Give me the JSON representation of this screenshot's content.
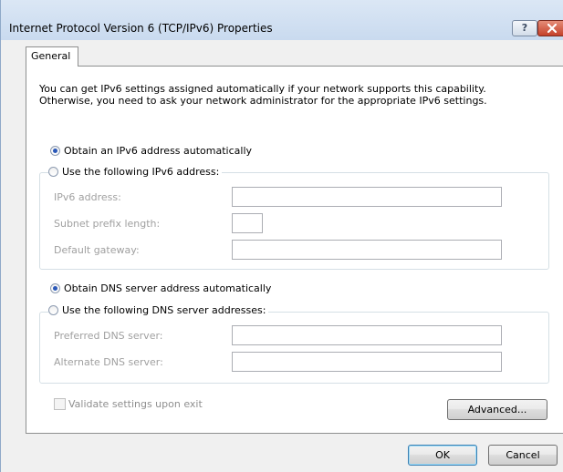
{
  "window": {
    "title": "Internet Protocol Version 6 (TCP/IPv6) Properties",
    "help_label": "?"
  },
  "tabs": [
    {
      "label": "General"
    }
  ],
  "description": {
    "line1": "You can get IPv6 settings assigned automatically if your network supports this capability.",
    "line2": "Otherwise, you need to ask your network administrator for the appropriate IPv6 settings."
  },
  "ip_section": {
    "auto_label": "Obtain an IPv6 address automatically",
    "auto_checked": true,
    "manual_label": "Use the following IPv6 address:",
    "manual_checked": false,
    "fields": {
      "address_label": "IPv6 address:",
      "address_value": "",
      "prefix_label": "Subnet prefix length:",
      "prefix_value": "",
      "gateway_label": "Default gateway:",
      "gateway_value": ""
    }
  },
  "dns_section": {
    "auto_label": "Obtain DNS server address automatically",
    "auto_checked": true,
    "manual_label": "Use the following DNS server addresses:",
    "manual_checked": false,
    "fields": {
      "preferred_label": "Preferred DNS server:",
      "preferred_value": "",
      "alternate_label": "Alternate DNS server:",
      "alternate_value": ""
    }
  },
  "validate": {
    "label": "Validate settings upon exit",
    "checked": false,
    "enabled": false
  },
  "buttons": {
    "advanced": "Advanced...",
    "ok": "OK",
    "cancel": "Cancel"
  },
  "colors": {
    "titlebar": "#c9daef",
    "close_button": "#c5412a",
    "radio_dot": "#2a58b8",
    "disabled_text": "#a0a0a0",
    "default_button_border": "#3c7fb1"
  }
}
